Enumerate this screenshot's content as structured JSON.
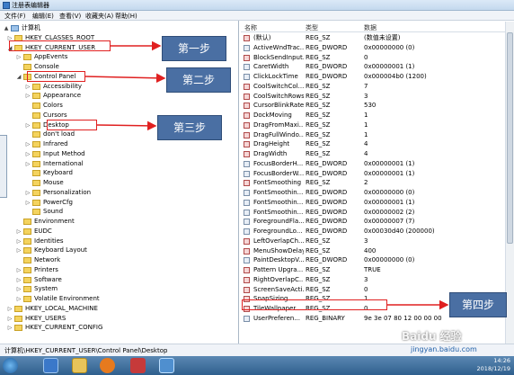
{
  "window": {
    "title": "注册表编辑器"
  },
  "menu": [
    "文件(F)",
    "编辑(E)",
    "查看(V)",
    "收藏夹(A)",
    "帮助(H)"
  ],
  "tree": [
    {
      "label": "计算机",
      "level": 0,
      "arrow": "▲",
      "folder": false
    },
    {
      "label": "HKEY_CLASSES_ROOT",
      "level": 1,
      "arrow": "▷",
      "folder": true
    },
    {
      "label": "HKEY_CURRENT_USER",
      "level": 1,
      "arrow": "◢",
      "folder": true
    },
    {
      "label": "AppEvents",
      "level": 2,
      "arrow": "▷",
      "folder": true
    },
    {
      "label": "Console",
      "level": 2,
      "arrow": "",
      "folder": true
    },
    {
      "label": "Control Panel",
      "level": 2,
      "arrow": "◢",
      "folder": true
    },
    {
      "label": "Accessibility",
      "level": 3,
      "arrow": "▷",
      "folder": true
    },
    {
      "label": "Appearance",
      "level": 3,
      "arrow": "▷",
      "folder": true
    },
    {
      "label": "Colors",
      "level": 3,
      "arrow": "",
      "folder": true
    },
    {
      "label": "Cursors",
      "level": 3,
      "arrow": "",
      "folder": true
    },
    {
      "label": "Desktop",
      "level": 3,
      "arrow": "▷",
      "folder": true
    },
    {
      "label": "don't load",
      "level": 3,
      "arrow": "",
      "folder": true
    },
    {
      "label": "Infrared",
      "level": 3,
      "arrow": "▷",
      "folder": true
    },
    {
      "label": "Input Method",
      "level": 3,
      "arrow": "▷",
      "folder": true
    },
    {
      "label": "International",
      "level": 3,
      "arrow": "▷",
      "folder": true
    },
    {
      "label": "Keyboard",
      "level": 3,
      "arrow": "",
      "folder": true
    },
    {
      "label": "Mouse",
      "level": 3,
      "arrow": "",
      "folder": true
    },
    {
      "label": "Personalization",
      "level": 3,
      "arrow": "▷",
      "folder": true
    },
    {
      "label": "PowerCfg",
      "level": 3,
      "arrow": "▷",
      "folder": true
    },
    {
      "label": "Sound",
      "level": 3,
      "arrow": "",
      "folder": true
    },
    {
      "label": "Environment",
      "level": 2,
      "arrow": "",
      "folder": true
    },
    {
      "label": "EUDC",
      "level": 2,
      "arrow": "▷",
      "folder": true
    },
    {
      "label": "Identities",
      "level": 2,
      "arrow": "▷",
      "folder": true
    },
    {
      "label": "Keyboard Layout",
      "level": 2,
      "arrow": "▷",
      "folder": true
    },
    {
      "label": "Network",
      "level": 2,
      "arrow": "",
      "folder": true
    },
    {
      "label": "Printers",
      "level": 2,
      "arrow": "▷",
      "folder": true
    },
    {
      "label": "Software",
      "level": 2,
      "arrow": "▷",
      "folder": true
    },
    {
      "label": "System",
      "level": 2,
      "arrow": "▷",
      "folder": true
    },
    {
      "label": "Volatile Environment",
      "level": 2,
      "arrow": "▷",
      "folder": true
    },
    {
      "label": "HKEY_LOCAL_MACHINE",
      "level": 1,
      "arrow": "▷",
      "folder": true
    },
    {
      "label": "HKEY_USERS",
      "level": 1,
      "arrow": "▷",
      "folder": true
    },
    {
      "label": "HKEY_CURRENT_CONFIG",
      "level": 1,
      "arrow": "▷",
      "folder": true
    }
  ],
  "columns": {
    "name": "名称",
    "type": "类型",
    "data": "数据"
  },
  "values": [
    {
      "name": "(默认)",
      "type": "REG_SZ",
      "data": "(数值未设置)"
    },
    {
      "name": "ActiveWndTrac...",
      "type": "REG_DWORD",
      "data": "0x00000000 (0)"
    },
    {
      "name": "BlockSendInput...",
      "type": "REG_SZ",
      "data": "0"
    },
    {
      "name": "CaretWidth",
      "type": "REG_DWORD",
      "data": "0x00000001 (1)"
    },
    {
      "name": "ClickLockTime",
      "type": "REG_DWORD",
      "data": "0x000004b0 (1200)"
    },
    {
      "name": "CoolSwitchCol...",
      "type": "REG_SZ",
      "data": "7"
    },
    {
      "name": "CoolSwitchRows",
      "type": "REG_SZ",
      "data": "3"
    },
    {
      "name": "CursorBlinkRate",
      "type": "REG_SZ",
      "data": "530"
    },
    {
      "name": "DockMoving",
      "type": "REG_SZ",
      "data": "1"
    },
    {
      "name": "DragFromMaxi...",
      "type": "REG_SZ",
      "data": "1"
    },
    {
      "name": "DragFullWindo...",
      "type": "REG_SZ",
      "data": "1"
    },
    {
      "name": "DragHeight",
      "type": "REG_SZ",
      "data": "4"
    },
    {
      "name": "DragWidth",
      "type": "REG_SZ",
      "data": "4"
    },
    {
      "name": "FocusBorderH...",
      "type": "REG_DWORD",
      "data": "0x00000001 (1)"
    },
    {
      "name": "FocusBorderW...",
      "type": "REG_DWORD",
      "data": "0x00000001 (1)"
    },
    {
      "name": "FontSmoothing",
      "type": "REG_SZ",
      "data": "2"
    },
    {
      "name": "FontSmoothin...",
      "type": "REG_DWORD",
      "data": "0x00000000 (0)"
    },
    {
      "name": "FontSmoothin...",
      "type": "REG_DWORD",
      "data": "0x00000001 (1)"
    },
    {
      "name": "FontSmoothin...",
      "type": "REG_DWORD",
      "data": "0x00000002 (2)"
    },
    {
      "name": "ForegroundFla...",
      "type": "REG_DWORD",
      "data": "0x00000007 (7)"
    },
    {
      "name": "ForegroundLo...",
      "type": "REG_DWORD",
      "data": "0x00030d40 (200000)"
    },
    {
      "name": "LeftOverlapCh...",
      "type": "REG_SZ",
      "data": "3"
    },
    {
      "name": "MenuShowDelay",
      "type": "REG_SZ",
      "data": "400"
    },
    {
      "name": "PaintDesktopV...",
      "type": "REG_DWORD",
      "data": "0x00000000 (0)"
    },
    {
      "name": "Pattern Upgra...",
      "type": "REG_SZ",
      "data": "TRUE"
    },
    {
      "name": "RightOverlapC...",
      "type": "REG_SZ",
      "data": "3"
    },
    {
      "name": "ScreenSaveActi...",
      "type": "REG_SZ",
      "data": "0"
    },
    {
      "name": "SnapSizing",
      "type": "REG_SZ",
      "data": "1"
    },
    {
      "name": "TileWallpaper",
      "type": "REG_SZ",
      "data": "0"
    },
    {
      "name": "UserPreferen...",
      "type": "REG_BINARY",
      "data": "9e 3e 07 80 12 00 00 00"
    }
  ],
  "status_path": "计算机\\HKEY_CURRENT_USER\\Control Panel\\Desktop",
  "callouts": [
    "第一步",
    "第二步",
    "第三步",
    "第四步"
  ],
  "clock": {
    "time": "14:26",
    "date": "2018/12/19"
  },
  "watermark": {
    "brand": "Baidu 经验",
    "url": "jingyan.baidu.com"
  },
  "colors": {
    "callout": "#4a6fa3",
    "highlight": "#e02020",
    "taskbar": "#2f5f8d"
  }
}
